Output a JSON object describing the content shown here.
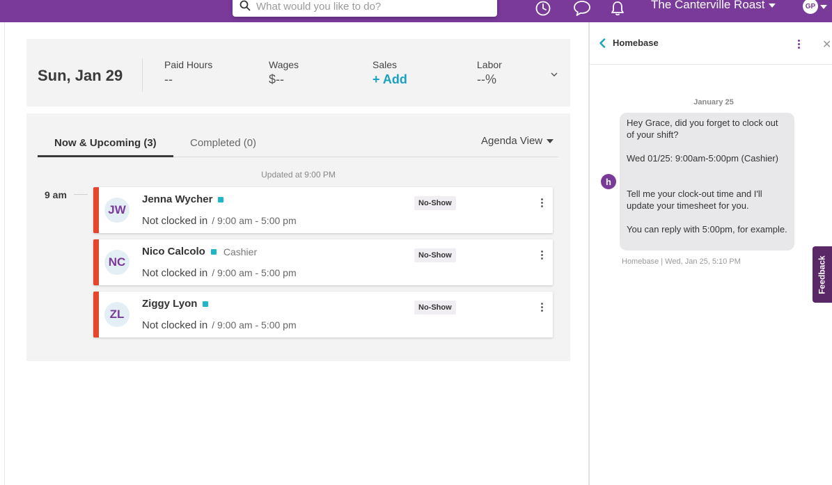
{
  "topbar": {
    "search_placeholder": "What would you like to do?",
    "location": "The Canterville Roast",
    "user_initials": "GP",
    "icons": [
      "history-icon",
      "chat-icon",
      "bell-icon"
    ],
    "brand_color": "#7a3a9a"
  },
  "summary": {
    "date": "Sun, Jan 29",
    "stats": [
      {
        "label": "Paid Hours",
        "value": "--"
      },
      {
        "label": "Wages",
        "value": "$--"
      },
      {
        "label": "Sales",
        "value": "+ Add"
      },
      {
        "label": "Labor",
        "value": "--%"
      }
    ]
  },
  "shifts": {
    "tabs": [
      {
        "label": "Now & Upcoming (3)"
      },
      {
        "label": "Completed (0)"
      }
    ],
    "view": "Agenda View",
    "updated": "Updated at 9:00 PM",
    "time_label": "9 am",
    "items": [
      {
        "initials": "JW",
        "name": "Jenna Wycher",
        "role": "",
        "status": "Not clocked in",
        "hours": "/ 9:00 am - 5:00 pm",
        "badge": "No-Show"
      },
      {
        "initials": "NC",
        "name": "Nico Calcolo",
        "role": "Cashier",
        "status": "Not clocked in",
        "hours": "/ 9:00 am - 5:00 pm",
        "badge": "No-Show"
      },
      {
        "initials": "ZL",
        "name": "Ziggy Lyon",
        "role": "",
        "status": "Not clocked in",
        "hours": "/ 9:00 am - 5:00 pm",
        "badge": "No-Show"
      }
    ]
  },
  "panel": {
    "title": "Homebase",
    "date": "January 25",
    "avatar_letter": "h",
    "message": {
      "p1": "Hey Grace, did you forget to clock out of your shift?",
      "p2": "Wed 01/25: 9:00am-5:00pm (Cashier)",
      "p3": "Tell me your clock-out time and I'll update your timesheet for you.",
      "p4": "You can reply with 5:00pm, for example."
    },
    "meta": "Homebase | Wed, Jan 25, 5:10 PM"
  },
  "feedback_label": "Feedback"
}
